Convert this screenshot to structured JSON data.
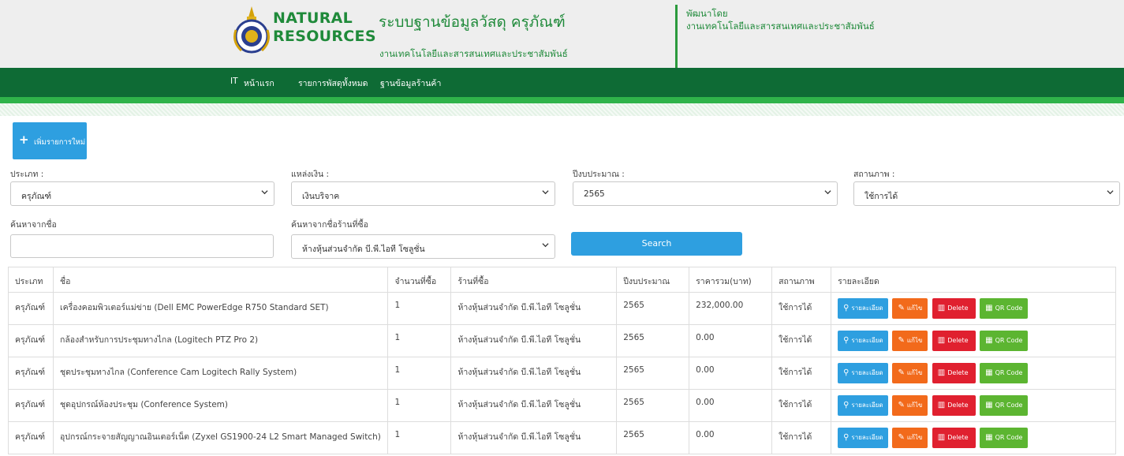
{
  "header": {
    "brand_line1": "NATURAL",
    "brand_line2": "RESOURCES",
    "system_title": "ระบบฐานข้อมูลวัสดุ ครุภัณฑ์",
    "system_subtitle": "งานเทคโนโลยีและสารสนเทศและประชาสัมพันธ์",
    "developed_by_label": "พัฒนาโดย",
    "developed_by": "งานเทคโนโลยีและสารสนเทศและประชาสัมพันธ์"
  },
  "nav": {
    "items": [
      "IT",
      "หน้าแรก",
      "รายการพัสดุทั้งหมด",
      "ฐานข้อมูลร้านค้า"
    ]
  },
  "add_button": "เพิ่มรายการใหม่",
  "filters": {
    "type_label": "ประเภท :",
    "type_value": "ครุภัณฑ์",
    "fund_label": "แหล่งเงิน :",
    "fund_value": "เงินบริจาค",
    "year_label": "ปีงบประมาณ :",
    "year_value": "2565",
    "status_label": "สถานภาพ :",
    "status_value": "ใช้การได้",
    "name_search_label": "ค้นหาจากชื่อ",
    "name_search_value": "",
    "shop_search_label": "ค้นหาจากชื่อร้านที่ซื้อ",
    "shop_search_value": "ห้างหุ้นส่วนจำกัด บี.พี.ไอที โซลูชั่น",
    "search_button": "Search"
  },
  "table": {
    "columns": [
      "ประเภท",
      "ชื่อ",
      "จำนวนที่ซื้อ",
      "ร้านที่ซื้อ",
      "ปีงบประมาณ",
      "ราคารวม(บาท)",
      "สถานภาพ",
      "รายละเอียด"
    ],
    "rows": [
      {
        "type": "ครุภัณฑ์",
        "name": "เครื่องคอมพิวเตอร์แม่ข่าย (Dell EMC PowerEdge R750 Standard SET)",
        "qty": "1",
        "shop": "ห้างหุ้นส่วนจำกัด บี.พี.ไอที โซลูชั่น",
        "year": "2565",
        "price": "232,000.00",
        "status": "ใช้การได้"
      },
      {
        "type": "ครุภัณฑ์",
        "name": "กล้องสำหรับการประชุมทางไกล (Logitech PTZ Pro 2)",
        "qty": "1",
        "shop": "ห้างหุ้นส่วนจำกัด บี.พี.ไอที โซลูชั่น",
        "year": "2565",
        "price": "0.00",
        "status": "ใช้การได้"
      },
      {
        "type": "ครุภัณฑ์",
        "name": "ชุดประชุมทางไกล (Conference Cam Logitech Rally System)",
        "qty": "1",
        "shop": "ห้างหุ้นส่วนจำกัด บี.พี.ไอที โซลูชั่น",
        "year": "2565",
        "price": "0.00",
        "status": "ใช้การได้"
      },
      {
        "type": "ครุภัณฑ์",
        "name": "ชุดอุปกรณ์ห้องประชุม (Conference System)",
        "qty": "1",
        "shop": "ห้างหุ้นส่วนจำกัด บี.พี.ไอที โซลูชั่น",
        "year": "2565",
        "price": "0.00",
        "status": "ใช้การได้"
      },
      {
        "type": "ครุภัณฑ์",
        "name": "อุปกรณ์กระจายสัญญาณอินเตอร์เน็ต (Zyxel GS1900-24 L2 Smart Managed Switch)",
        "qty": "1",
        "shop": "ห้างหุ้นส่วนจำกัด บี.พี.ไอที โซลูชั่น",
        "year": "2565",
        "price": "0.00",
        "status": "ใช้การได้"
      }
    ],
    "actions": {
      "detail": "รายละเอียด",
      "edit": "แก้ไข",
      "delete": "Delete",
      "qr": "QR Code"
    }
  }
}
